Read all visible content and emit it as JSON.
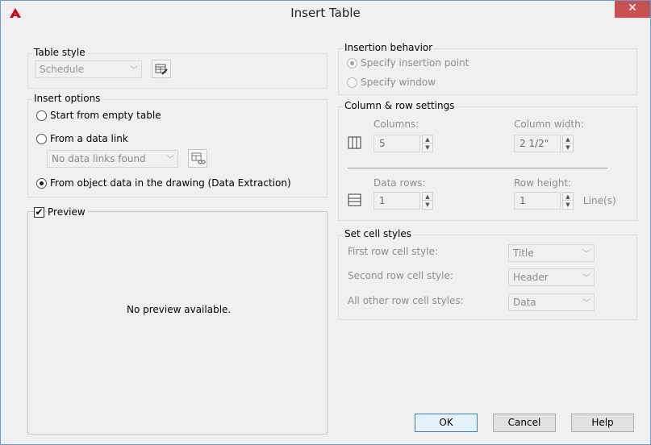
{
  "window": {
    "title": "Insert Table",
    "close_glyph": "✕",
    "accent": "#c75050"
  },
  "table_style": {
    "group_label": "Table style",
    "selected": "Schedule",
    "launch_icon": "table-style-dialog-icon"
  },
  "insert_options": {
    "group_label": "Insert options",
    "opt_empty": "Start from empty table",
    "opt_data_link": "From a data link",
    "data_link_selected": "No data links found",
    "opt_object_data": "From object data in the drawing (Data Extraction)",
    "selected_option": "opt_object_data"
  },
  "preview": {
    "label": "Preview",
    "checked": true,
    "message": "No preview available."
  },
  "insertion_behavior": {
    "group_label": "Insertion behavior",
    "opt_point": "Specify insertion point",
    "opt_window": "Specify window"
  },
  "column_row": {
    "group_label": "Column & row settings",
    "columns_label": "Columns:",
    "columns_value": "5",
    "column_width_label": "Column width:",
    "column_width_value": "2 1/2\"",
    "data_rows_label": "Data rows:",
    "data_rows_value": "1",
    "row_height_label": "Row height:",
    "row_height_value": "1",
    "row_height_unit": "Line(s)"
  },
  "cell_styles": {
    "group_label": "Set cell styles",
    "first_row_label": "First row cell style:",
    "first_row_value": "Title",
    "second_row_label": "Second row cell style:",
    "second_row_value": "Header",
    "other_rows_label": "All other row cell styles:",
    "other_rows_value": "Data"
  },
  "buttons": {
    "ok": "OK",
    "cancel": "Cancel",
    "help": "Help"
  }
}
